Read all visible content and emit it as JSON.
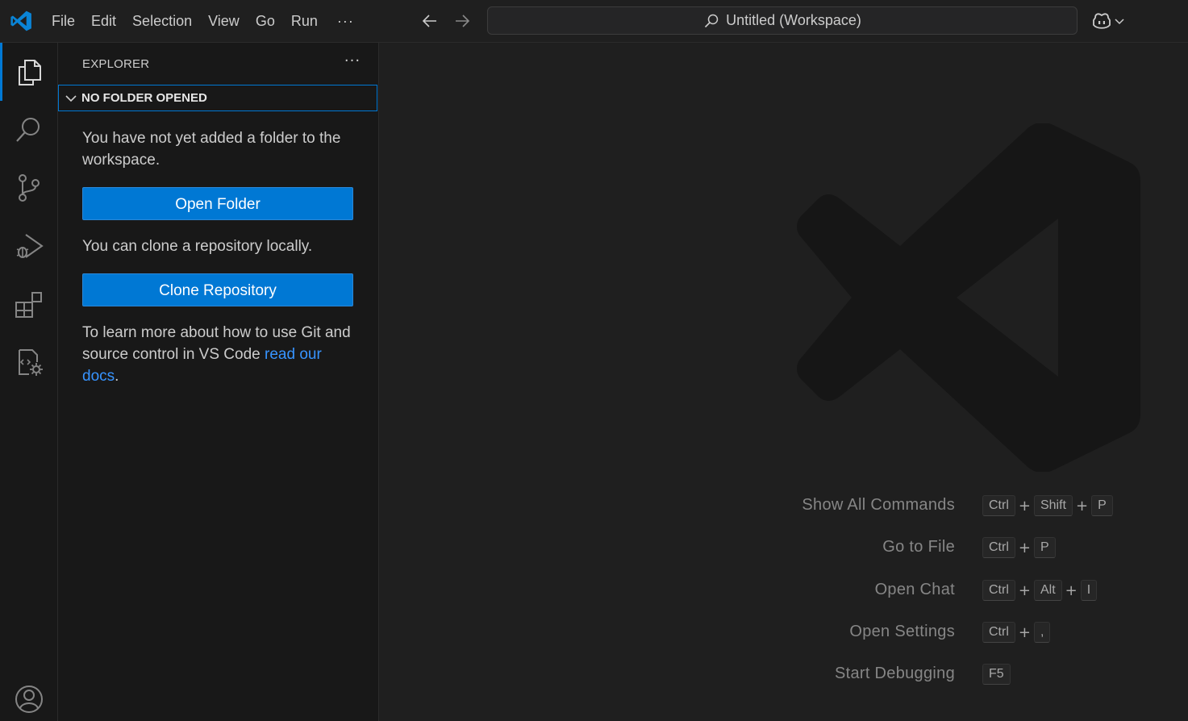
{
  "titlebar": {
    "menu": [
      "File",
      "Edit",
      "Selection",
      "View",
      "Go",
      "Run"
    ],
    "more_label": "···",
    "command_center": "Untitled (Workspace)",
    "icons": [
      "vscode-logo-icon",
      "back-arrow-icon",
      "forward-arrow-icon",
      "search-icon",
      "copilot-icon",
      "chevron-down-icon"
    ]
  },
  "activitybar": {
    "items": [
      "explorer-icon",
      "search-icon",
      "source-control-icon",
      "run-debug-icon",
      "extensions-icon",
      "remote-explorer-icon"
    ],
    "bottom": [
      "accounts-icon"
    ],
    "active_color": "#0078d4"
  },
  "sidebar": {
    "header": "EXPLORER",
    "more_label": "···",
    "section_title": "NO FOLDER OPENED",
    "text_1": "You have not yet added a folder to the workspace.",
    "open_folder_label": "Open Folder",
    "text_2": "You can clone a repository locally.",
    "clone_label": "Clone Repository",
    "text_3_prefix": "To learn more about how to use Git and source control in VS Code ",
    "text_3_link": "read our docs",
    "text_3_suffix": ".",
    "button_color": "#0078d4",
    "link_color": "#3794ff"
  },
  "editor": {
    "shortcuts": [
      {
        "label": "Show All Commands",
        "keys": [
          "Ctrl",
          "Shift",
          "P"
        ]
      },
      {
        "label": "Go to File",
        "keys": [
          "Ctrl",
          "P"
        ]
      },
      {
        "label": "Open Chat",
        "keys": [
          "Ctrl",
          "Alt",
          "I"
        ]
      },
      {
        "label": "Open Settings",
        "keys": [
          "Ctrl",
          ","
        ]
      },
      {
        "label": "Start Debugging",
        "keys": [
          "F5"
        ]
      }
    ]
  }
}
